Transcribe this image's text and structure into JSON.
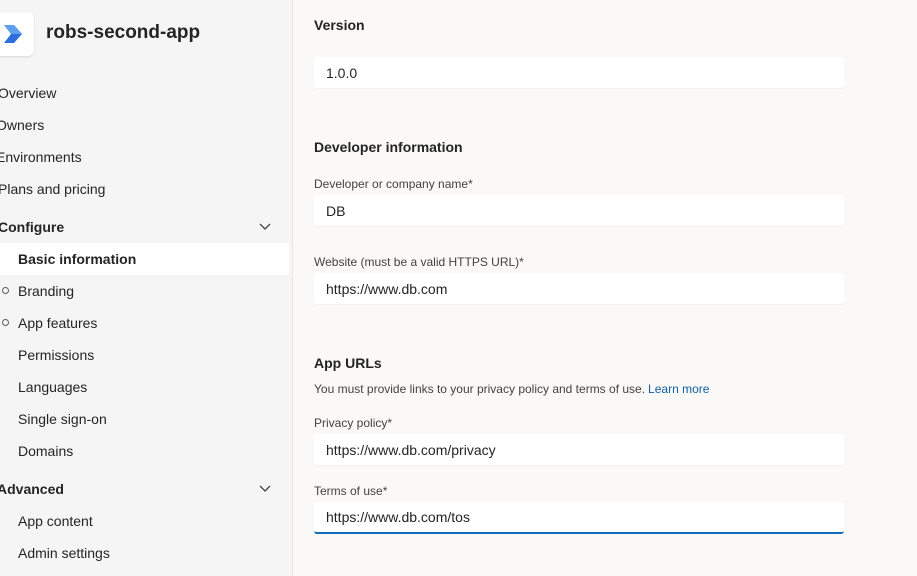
{
  "app": {
    "name": "robs-second-app"
  },
  "sidebar": {
    "items": [
      {
        "label": "Overview"
      },
      {
        "label": "Owners"
      },
      {
        "label": "Environments"
      },
      {
        "label": "Plans and pricing"
      }
    ],
    "configure": {
      "label": "Configure",
      "items": [
        {
          "label": "Basic information"
        },
        {
          "label": "Branding"
        },
        {
          "label": "App features"
        },
        {
          "label": "Permissions"
        },
        {
          "label": "Languages"
        },
        {
          "label": "Single sign-on"
        },
        {
          "label": "Domains"
        }
      ]
    },
    "advanced": {
      "label": "Advanced",
      "items": [
        {
          "label": "App content"
        },
        {
          "label": "Admin settings"
        }
      ]
    }
  },
  "main": {
    "version": {
      "title": "Version",
      "value": "1.0.0"
    },
    "developer": {
      "title": "Developer information",
      "name_label": "Developer or company name*",
      "name_value": "DB",
      "website_label": "Website (must be a valid HTTPS URL)*",
      "website_value": "https://www.db.com"
    },
    "app_urls": {
      "title": "App URLs",
      "helper": "You must provide links to your privacy policy and terms of use.",
      "learn_more": "Learn more",
      "privacy_label": "Privacy policy*",
      "privacy_value": "https://www.db.com/privacy",
      "terms_label": "Terms of use*",
      "terms_value": "https://www.db.com/tos"
    }
  },
  "colors": {
    "accent": "#0f6cbd",
    "link": "#115ea3",
    "logo_blue": "#2f6fdc"
  }
}
